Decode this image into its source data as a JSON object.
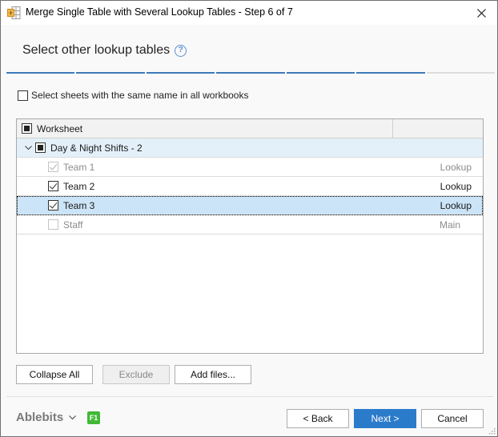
{
  "window": {
    "title": "Merge Single Table with Several Lookup Tables - Step 6 of 7",
    "app_icon": "table-merge-icon",
    "close_icon": "close-icon"
  },
  "header": {
    "title": "Select other lookup tables",
    "help_icon": "help-icon",
    "help_glyph": "?"
  },
  "steps": {
    "total": 7,
    "completed": 6,
    "accent_color": "#3f7ab8"
  },
  "options": {
    "same_name_label": "Select sheets with the same name in all workbooks",
    "same_name_checked": false
  },
  "grid": {
    "columns": [
      "Worksheet",
      ""
    ],
    "groups": [
      {
        "name": "Day & Night Shifts - 2",
        "expanded": true,
        "state": "indeterminate",
        "rows": [
          {
            "name": "Team 1",
            "type": "Lookup",
            "checked": true,
            "disabled": true,
            "selected": false
          },
          {
            "name": "Team 2",
            "type": "Lookup",
            "checked": true,
            "disabled": false,
            "selected": false
          },
          {
            "name": "Team 3",
            "type": "Lookup",
            "checked": true,
            "disabled": false,
            "selected": true
          },
          {
            "name": "Staff",
            "type": "Main",
            "checked": false,
            "disabled": true,
            "selected": false
          }
        ]
      }
    ]
  },
  "actions": {
    "collapse_all": "Collapse All",
    "exclude": "Exclude",
    "add_files": "Add files..."
  },
  "footer": {
    "brand": "Ablebits",
    "f1_badge": "F1",
    "back": "< Back",
    "next": "Next >",
    "cancel": "Cancel",
    "primary_color": "#2b7bcb"
  }
}
